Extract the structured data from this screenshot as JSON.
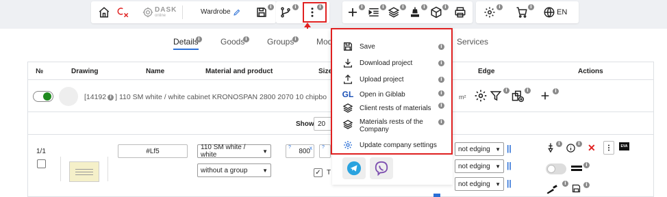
{
  "toolbar": {
    "logo_text": "DASK",
    "logo_sub": "online",
    "project_name": "Wardrobe",
    "language": "EN"
  },
  "tabs": [
    "Details",
    "Goods",
    "Groups",
    "Mod",
    "Services"
  ],
  "table": {
    "headers": {
      "num": "№",
      "drawing": "Drawing",
      "name": "Name",
      "material": "Material and product",
      "size": "Size",
      "edge": "Edge",
      "actions": "Actions"
    },
    "material_row": {
      "id": "[14192",
      "text": "] 110 SM white / white cabinet KRONOSPAN 2800 2070 10 chipbo",
      "unit": "m²"
    },
    "show_label": "Show",
    "show_value": "20",
    "detail": {
      "number": "1/1",
      "name": "#Lf5",
      "material": "110 SM white / white",
      "group": "without a group",
      "size_value": "800",
      "size_prefix": "?",
      "size_x": "x",
      "size_prefix2": "?",
      "size_partial": "€",
      "t_label": "T",
      "edge_options": [
        "not edging",
        "not edging",
        "not edging"
      ],
      "eva_label": "EVA"
    }
  },
  "dropdown_menu": {
    "items": [
      {
        "label": "Save",
        "icon": "save-icon"
      },
      {
        "label": "Download project",
        "icon": "download-icon"
      },
      {
        "label": "Upload project",
        "icon": "upload-icon"
      },
      {
        "label": "Open in Giblab",
        "icon": "giblab-icon",
        "icon_text": "GL"
      },
      {
        "label": "Client rests of materials",
        "icon": "layers-icon"
      },
      {
        "label": "Materials rests of the Company",
        "icon": "layers-icon"
      },
      {
        "label": "Update company settings",
        "icon": "settings-sync-icon"
      }
    ],
    "messengers": [
      "telegram-icon",
      "viber-icon"
    ]
  },
  "colors": {
    "accent": "#2a6fd6",
    "highlight_border": "#e02020",
    "toggle_on": "#1f8a1f",
    "red_icon": "#e02020"
  }
}
